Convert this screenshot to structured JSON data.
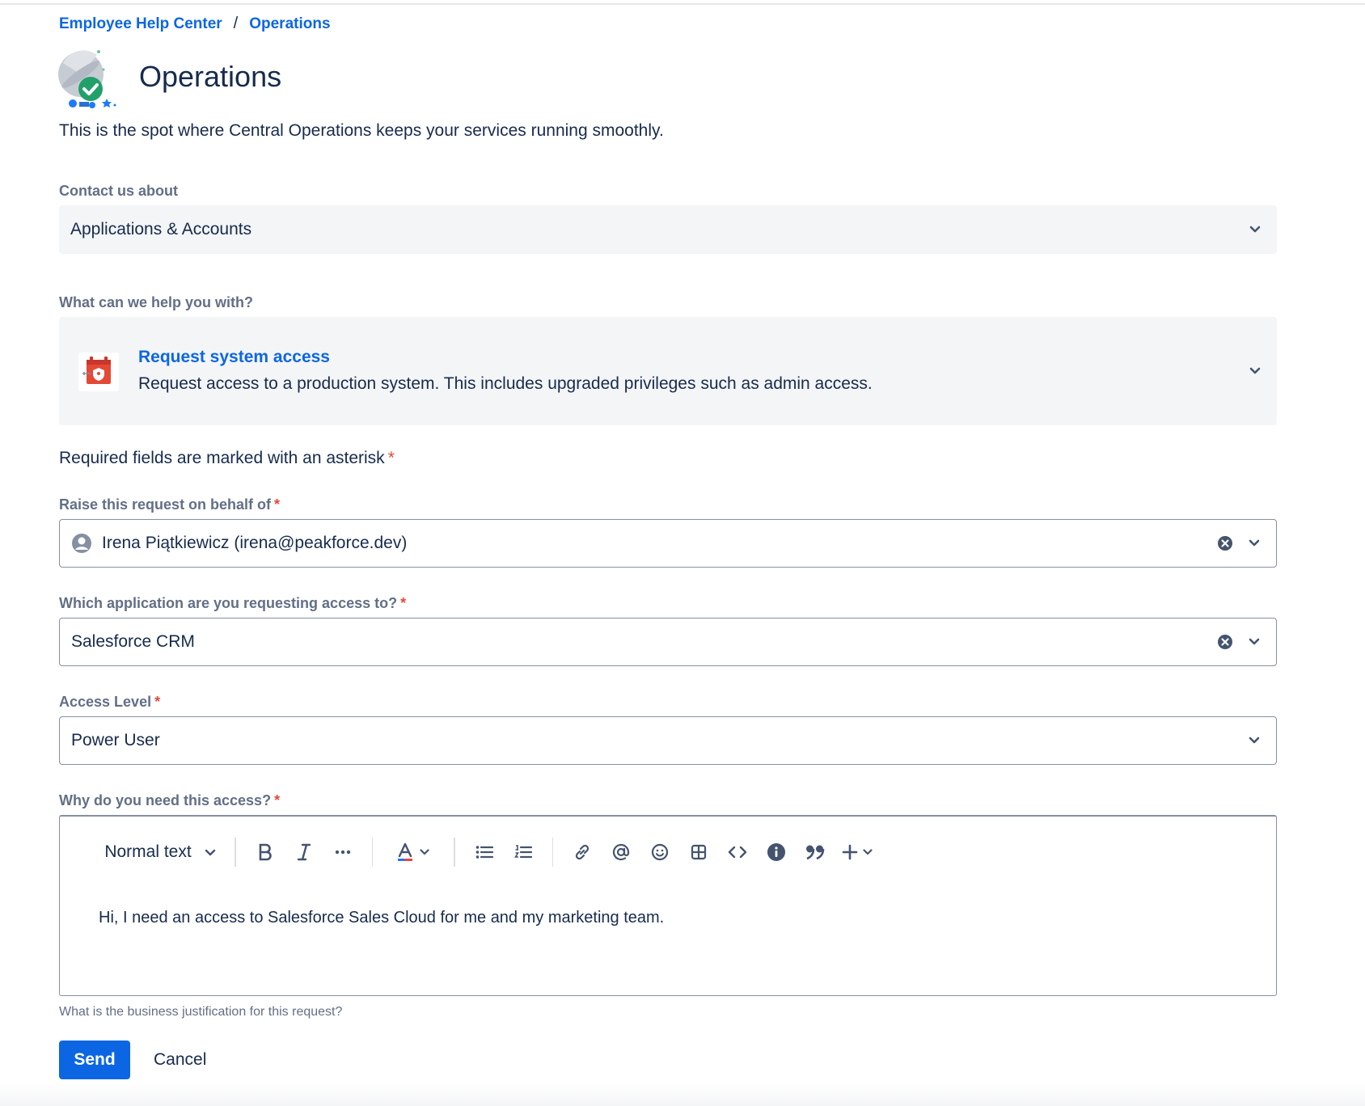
{
  "breadcrumb": {
    "home": "Employee Help Center",
    "separator": "/",
    "current": "Operations"
  },
  "header": {
    "title": "Operations",
    "description": "This is the spot where Central Operations keeps your services running smoothly."
  },
  "contact": {
    "label": "Contact us about",
    "value": "Applications & Accounts"
  },
  "help": {
    "label": "What can we help you with?",
    "request_title": "Request system access",
    "request_desc": "Request access to a production system. This includes upgraded privileges such as admin access."
  },
  "required_note": "Required fields are marked with an asterisk",
  "asterisk": "*",
  "behalf": {
    "label": "Raise this request on behalf of",
    "value": "Irena Piątkiewicz (irena@peakforce.dev)"
  },
  "application": {
    "label": "Which application are you requesting access to?",
    "value": "Salesforce CRM"
  },
  "access_level": {
    "label": "Access Level",
    "value": "Power User"
  },
  "reason": {
    "label": "Why do you need this access?",
    "text_style": "Normal text",
    "body": "Hi, I need an access to Salesforce Sales Cloud for me and my marketing team.",
    "helper": "What is the business justification for this request?"
  },
  "toolbar_icons": [
    "bold-icon",
    "italic-icon",
    "more-icon",
    "text-color-icon",
    "bullet-list-icon",
    "numbered-list-icon",
    "link-icon",
    "mention-icon",
    "emoji-icon",
    "table-icon",
    "code-icon",
    "info-panel-icon",
    "quote-icon",
    "insert-plus-icon"
  ],
  "actions": {
    "send": "Send",
    "cancel": "Cancel"
  },
  "colors": {
    "link": "#0c66e4",
    "primary_button": "#0c66e4",
    "required": "#e5493a",
    "field_bg": "#f4f5f7"
  }
}
